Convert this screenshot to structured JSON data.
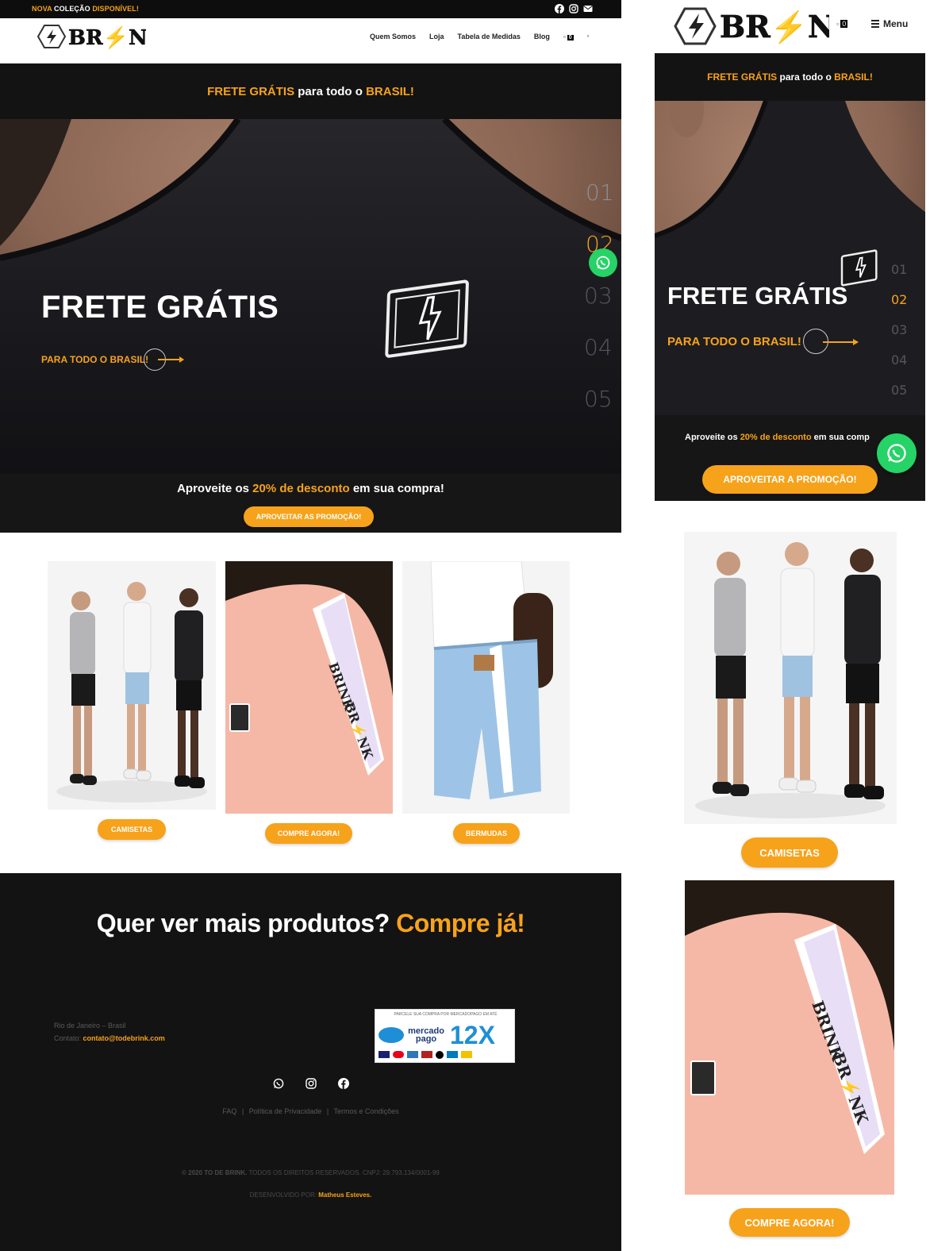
{
  "colors": {
    "accent": "#f7a21b",
    "dark": "#131313",
    "whatsapp": "#25d366"
  },
  "desktop": {
    "topbar": {
      "promo_word1": "NOVA",
      "promo_word2": "COLEÇÃO",
      "promo_word3": "DISPONÍVEL!",
      "social_icons": [
        "facebook-icon",
        "instagram-icon",
        "mail-icon"
      ]
    },
    "header": {
      "logo_text": "BR⚡NK",
      "nav": [
        "Quem Somos",
        "Loja",
        "Tabela de Medidas",
        "Blog"
      ],
      "cart_count": "0"
    },
    "frete_band": {
      "part1": "FRETE GRÁTIS",
      "part2": " para todo o ",
      "part3": "BRASIL!"
    },
    "hero": {
      "title": "FRETE GRÁTIS",
      "subtitle": "PARA TODO O BRASIL!",
      "slides": [
        "01",
        "02",
        "03",
        "04",
        "05"
      ],
      "active_slide": "02"
    },
    "promo": {
      "part1": "Aproveite os ",
      "part2": "20% de desconto",
      "part3": " em sua compra!",
      "button": "APROVEITAR AS PROMOÇÃO!"
    },
    "products": [
      {
        "button": "CAMISETAS"
      },
      {
        "button": "COMPRE AGORA!"
      },
      {
        "button": "BERMUDAS"
      }
    ],
    "cta": {
      "part1": "Quer ver mais produtos? ",
      "part2": "Compre já!"
    },
    "footer": {
      "location": "Rio de Janeiro – Brasil",
      "contact_label": "Contato: ",
      "contact_email": "contato@todebrink.com",
      "payment_header": "PARCELE SUA COMPRA POR MERCADOPAGO EM ATÉ",
      "payment_brand": "mercado pago",
      "payment_installments": "12X",
      "social_icons": [
        "whatsapp-icon",
        "instagram-icon",
        "facebook-icon"
      ],
      "links": [
        "FAQ",
        "Política de Privacidade",
        "Termos e Condições"
      ],
      "copyright_strong": "© 2020 TO DE BRINK.",
      "copyright_rest": " TODOS OS DIREITOS RESERVADOS. CNPJ: 29.793.134/0001-99",
      "dev_label": "DESENVOLVIDO POR: ",
      "dev_name": "Matheus Esteves."
    }
  },
  "mobile": {
    "header": {
      "logo_text": "BR⚡NK",
      "cart_count": "0",
      "menu_label": "Menu"
    },
    "frete_band": {
      "part1": "FRETE GRÁTIS",
      "part2": " para todo o ",
      "part3": "BRASIL!"
    },
    "hero": {
      "title": "FRETE GRÁTIS",
      "subtitle": "PARA TODO O BRASIL!",
      "slides": [
        "01",
        "02",
        "03",
        "04",
        "05"
      ]
    },
    "promo": {
      "part1": "Aproveite os ",
      "part2": "20% de desconto",
      "part3": " em sua comp",
      "button": "APROVEITAR A PROMOÇÃO!"
    },
    "products": [
      {
        "button": "CAMISETAS"
      },
      {
        "button": "COMPRE AGORA!"
      }
    ]
  }
}
